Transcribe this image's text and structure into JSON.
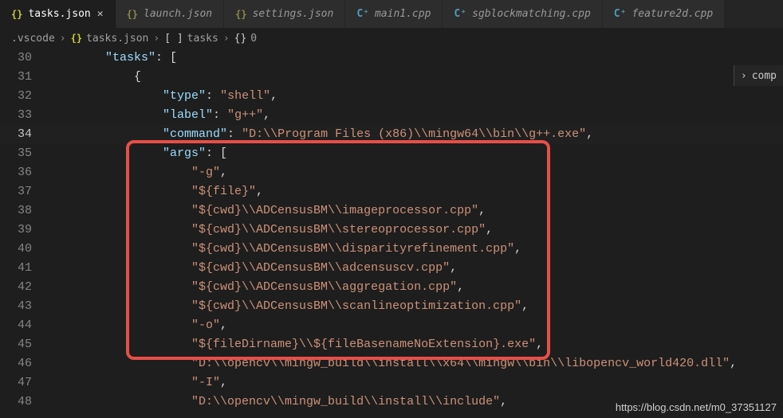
{
  "tabs": [
    {
      "label": "tasks.json",
      "icon": "{}",
      "icon_cls": "ico-json",
      "active": true,
      "closeable": true
    },
    {
      "label": "launch.json",
      "icon": "{}",
      "icon_cls": "ico-json dim",
      "active": false,
      "closeable": false
    },
    {
      "label": "settings.json",
      "icon": "{}",
      "icon_cls": "ico-json dim",
      "active": false,
      "closeable": false
    },
    {
      "label": "main1.cpp",
      "icon": "C⁺",
      "icon_cls": "ico-cpp",
      "active": false,
      "closeable": false
    },
    {
      "label": "sgblockmatching.cpp",
      "icon": "C⁺",
      "icon_cls": "ico-cpp",
      "active": false,
      "closeable": false
    },
    {
      "label": "feature2d.cpp",
      "icon": "C⁺",
      "icon_cls": "ico-cpp",
      "active": false,
      "closeable": false
    }
  ],
  "close_glyph": "✕",
  "breadcrumb": [
    {
      "icon": "",
      "icon_cls": "",
      "label": ".vscode"
    },
    {
      "icon": "{}",
      "icon_cls": "ico-json",
      "label": "tasks.json"
    },
    {
      "icon": "[ ]",
      "icon_cls": "ico-arr",
      "label": "tasks"
    },
    {
      "icon": "{}",
      "icon_cls": "ico-obj",
      "label": "0"
    }
  ],
  "breadcrumb_sep": "›",
  "side_panel": {
    "chevron": "›",
    "label": "comp"
  },
  "code": {
    "lines": [
      {
        "n": "30",
        "indent": "        ",
        "tokens": [
          [
            "key",
            "\"tasks\""
          ],
          [
            "pun",
            ": ["
          ]
        ]
      },
      {
        "n": "31",
        "indent": "            ",
        "tokens": [
          [
            "pun",
            "{"
          ]
        ]
      },
      {
        "n": "32",
        "indent": "                ",
        "tokens": [
          [
            "key",
            "\"type\""
          ],
          [
            "pun",
            ": "
          ],
          [
            "str",
            "\"shell\""
          ],
          [
            "pun",
            ","
          ]
        ]
      },
      {
        "n": "33",
        "indent": "                ",
        "tokens": [
          [
            "key",
            "\"label\""
          ],
          [
            "pun",
            ": "
          ],
          [
            "str",
            "\"g++\""
          ],
          [
            "pun",
            ","
          ]
        ]
      },
      {
        "n": "34",
        "indent": "                ",
        "tokens": [
          [
            "key",
            "\"command\""
          ],
          [
            "pun",
            ": "
          ],
          [
            "str",
            "\"D:\\\\Program Files (x86)\\\\mingw64\\\\bin\\\\g++.exe\""
          ],
          [
            "pun",
            ","
          ]
        ],
        "current": true
      },
      {
        "n": "35",
        "indent": "                ",
        "tokens": [
          [
            "key",
            "\"args\""
          ],
          [
            "pun",
            ": ["
          ]
        ]
      },
      {
        "n": "36",
        "indent": "                    ",
        "tokens": [
          [
            "str",
            "\"-g\""
          ],
          [
            "pun",
            ","
          ]
        ]
      },
      {
        "n": "37",
        "indent": "                    ",
        "tokens": [
          [
            "str",
            "\"${file}\""
          ],
          [
            "pun",
            ","
          ]
        ]
      },
      {
        "n": "38",
        "indent": "                    ",
        "tokens": [
          [
            "str",
            "\"${cwd}\\\\ADCensusBM\\\\imageprocessor.cpp\""
          ],
          [
            "pun",
            ","
          ]
        ]
      },
      {
        "n": "39",
        "indent": "                    ",
        "tokens": [
          [
            "str",
            "\"${cwd}\\\\ADCensusBM\\\\stereoprocessor.cpp\""
          ],
          [
            "pun",
            ","
          ]
        ]
      },
      {
        "n": "40",
        "indent": "                    ",
        "tokens": [
          [
            "str",
            "\"${cwd}\\\\ADCensusBM\\\\disparityrefinement.cpp\""
          ],
          [
            "pun",
            ","
          ]
        ]
      },
      {
        "n": "41",
        "indent": "                    ",
        "tokens": [
          [
            "str",
            "\"${cwd}\\\\ADCensusBM\\\\adcensuscv.cpp\""
          ],
          [
            "pun",
            ","
          ]
        ]
      },
      {
        "n": "42",
        "indent": "                    ",
        "tokens": [
          [
            "str",
            "\"${cwd}\\\\ADCensusBM\\\\aggregation.cpp\""
          ],
          [
            "pun",
            ","
          ]
        ]
      },
      {
        "n": "43",
        "indent": "                    ",
        "tokens": [
          [
            "str",
            "\"${cwd}\\\\ADCensusBM\\\\scanlineoptimization.cpp\""
          ],
          [
            "pun",
            ","
          ]
        ]
      },
      {
        "n": "44",
        "indent": "                    ",
        "tokens": [
          [
            "str",
            "\"-o\""
          ],
          [
            "pun",
            ","
          ]
        ]
      },
      {
        "n": "45",
        "indent": "                    ",
        "tokens": [
          [
            "str",
            "\"${fileDirname}\\\\${fileBasenameNoExtension}.exe\""
          ],
          [
            "pun",
            ","
          ]
        ]
      },
      {
        "n": "46",
        "indent": "                    ",
        "tokens": [
          [
            "str",
            "\"D:\\\\opencv\\\\mingw_build\\\\install\\\\x64\\\\mingw\\\\bin\\\\libopencv_world420.dll\""
          ],
          [
            "pun",
            ","
          ]
        ]
      },
      {
        "n": "47",
        "indent": "                    ",
        "tokens": [
          [
            "str",
            "\"-I\""
          ],
          [
            "pun",
            ","
          ]
        ]
      },
      {
        "n": "48",
        "indent": "                    ",
        "tokens": [
          [
            "str",
            "\"D:\\\\opencv\\\\mingw_build\\\\install\\\\include\""
          ],
          [
            "pun",
            ","
          ]
        ]
      }
    ]
  },
  "watermark": "https://blog.csdn.net/m0_37351127"
}
